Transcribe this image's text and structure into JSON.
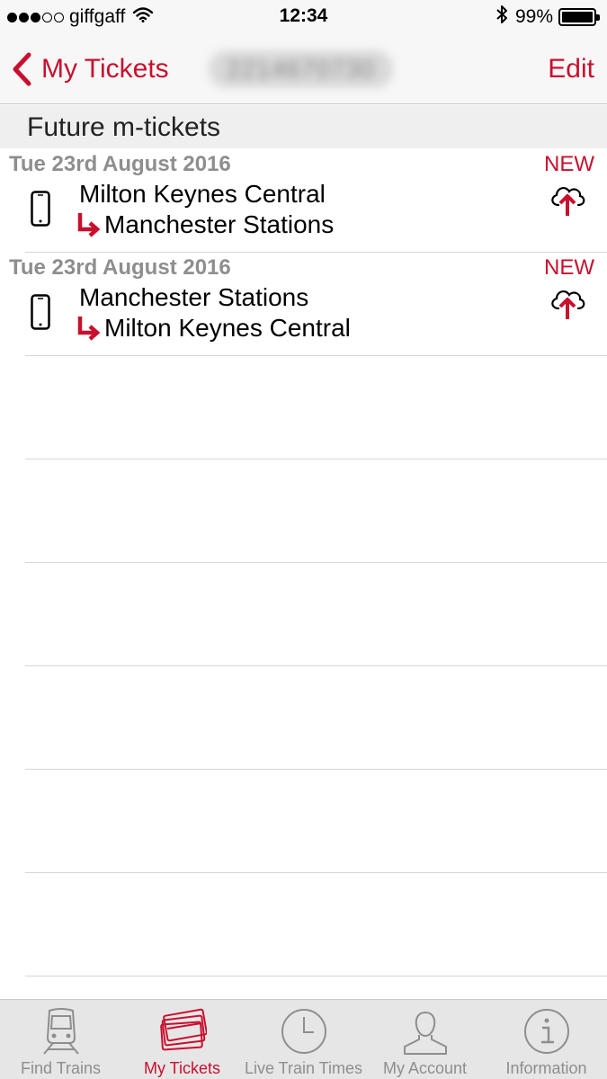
{
  "status_bar": {
    "signal_dots_filled": 3,
    "signal_dots_total": 5,
    "carrier": "giffgaff",
    "wifi_icon": "wifi-icon",
    "time": "12:34",
    "bluetooth_icon": "bluetooth-icon",
    "battery_percent": "99%",
    "battery_level": 0.99
  },
  "nav": {
    "back_label": "My Tickets",
    "title_obscured": "2214670730",
    "edit_label": "Edit"
  },
  "section": {
    "title": "Future m-tickets"
  },
  "tickets": [
    {
      "date": "Tue 23rd August 2016",
      "badge": "NEW",
      "from": "Milton Keynes Central",
      "to": "Manchester Stations",
      "icon": "phone-icon",
      "action_icon": "cloud-upload-icon"
    },
    {
      "date": "Tue 23rd August 2016",
      "badge": "NEW",
      "from": "Manchester Stations",
      "to": "Milton Keynes Central",
      "icon": "phone-icon",
      "action_icon": "cloud-upload-icon"
    }
  ],
  "tab_bar": {
    "active": "My Tickets",
    "items": [
      {
        "label": "Find Trains",
        "icon": "train-icon"
      },
      {
        "label": "My Tickets",
        "icon": "tickets-icon"
      },
      {
        "label": "Live Train Times",
        "icon": "clock-icon"
      },
      {
        "label": "My Account",
        "icon": "person-icon"
      },
      {
        "label": "Information",
        "icon": "info-icon"
      }
    ]
  },
  "colors": {
    "accent": "#c8102e",
    "inactive": "#8e8e8e",
    "bar_background": "#f7f7f7",
    "tab_background": "#e6e6e6"
  }
}
